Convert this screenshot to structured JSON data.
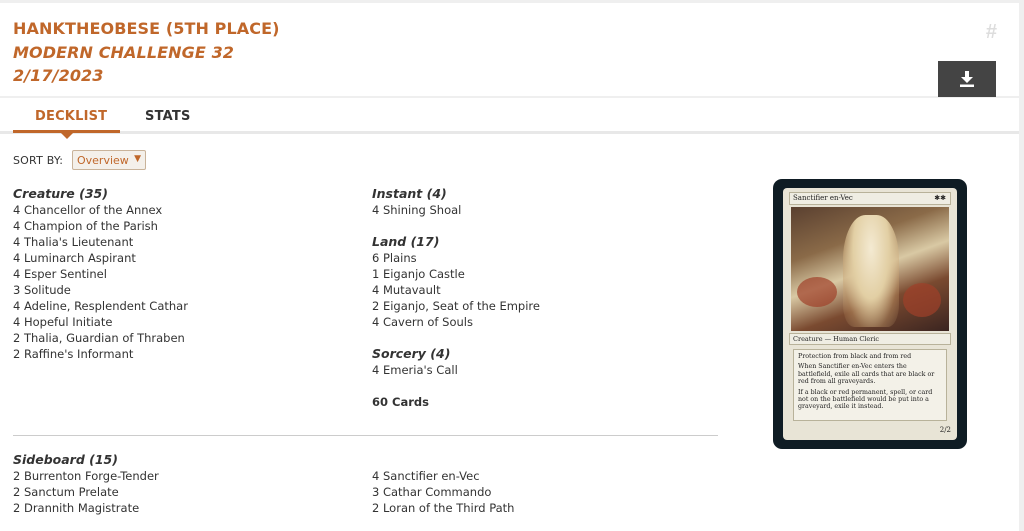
{
  "header": {
    "player": "HANKTHEOBESE (5TH PLACE)",
    "event": "MODERN CHALLENGE 32",
    "date": "2/17/2023",
    "hash_icon": "hash-icon",
    "download_icon": "download-icon"
  },
  "tabs": [
    {
      "label": "DECKLIST",
      "active": true
    },
    {
      "label": "STATS",
      "active": false
    }
  ],
  "sort": {
    "label": "SORT BY:",
    "selected": "Overview"
  },
  "deck": {
    "creature": {
      "heading": "Creature (35)",
      "cards": [
        "4 Chancellor of the Annex",
        "4 Champion of the Parish",
        "4 Thalia's Lieutenant",
        "4 Luminarch Aspirant",
        "4 Esper Sentinel",
        "3 Solitude",
        "4 Adeline, Resplendent Cathar",
        "4 Hopeful Initiate",
        "2 Thalia, Guardian of Thraben",
        "2 Raffine's Informant"
      ]
    },
    "instant": {
      "heading": "Instant (4)",
      "cards": [
        "4 Shining Shoal"
      ]
    },
    "land": {
      "heading": "Land (17)",
      "cards": [
        "6 Plains",
        "1 Eiganjo Castle",
        "4 Mutavault",
        "2 Eiganjo, Seat of the Empire",
        "4 Cavern of Souls"
      ]
    },
    "sorcery": {
      "heading": "Sorcery (4)",
      "cards": [
        "4 Emeria's Call"
      ]
    },
    "total": "60 Cards"
  },
  "sideboard": {
    "heading": "Sideboard (15)",
    "left": [
      "2 Burrenton Forge-Tender",
      "2 Sanctum Prelate",
      "2 Drannith Magistrate"
    ],
    "right": [
      "4 Sanctifier en-Vec",
      "3 Cathar Commando",
      "2 Loran of the Third Path"
    ]
  },
  "card_preview": {
    "name": "Sanctifier en-Vec",
    "mana": "✱✱",
    "type": "Creature — Human Cleric",
    "text_1": "Protection from black and from red",
    "text_2": "When Sanctifier en-Vec enters the battlefield, exile all cards that are black or red from all graveyards.",
    "text_3": "If a black or red permanent, spell, or card not on the battlefield would be put into a graveyard, exile it instead.",
    "pt": "2/2"
  }
}
